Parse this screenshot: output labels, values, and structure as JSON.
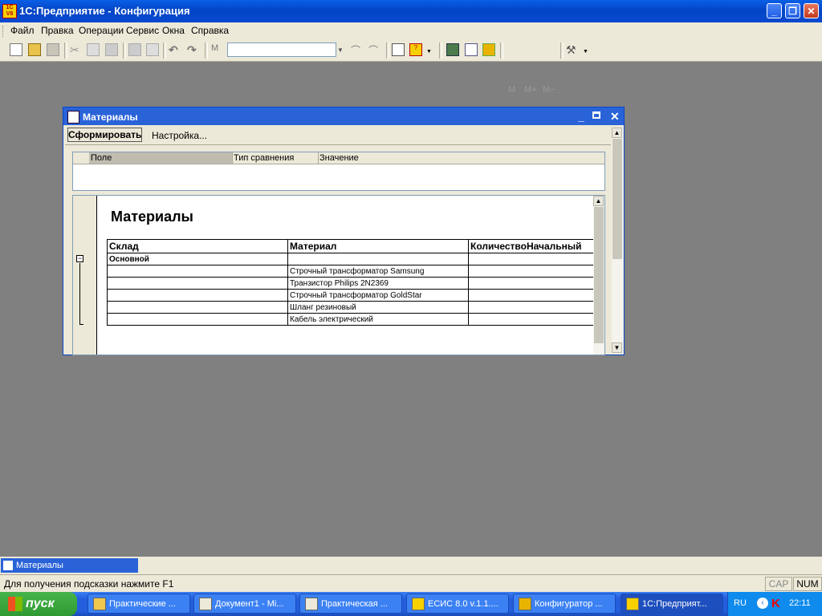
{
  "app": {
    "icon_text": "1C\nV8",
    "title": "1С:Предприятие - Конфигурация"
  },
  "menu": [
    "Файл",
    "Правка",
    "Операции",
    "Сервис",
    "Окна",
    "Справка"
  ],
  "toolbar": {
    "m_labels": [
      "M",
      "M+",
      "M−"
    ]
  },
  "window": {
    "title": "Материалы",
    "form_button": "Сформировать",
    "settings_button": "Настройка...",
    "filter_columns": [
      "Поле",
      "Тип сравнения",
      "Значение"
    ],
    "report_title": "Материалы",
    "table_headers": [
      "Склад",
      "Материал",
      "КоличествоНачальный"
    ],
    "group_row": "Основной",
    "materials": [
      "Строчный трансформатор Samsung",
      "Транзистор Philips 2N2369",
      "Строчный трансформатор GoldStar",
      "Шланг резиновый",
      "Кабель электрический"
    ]
  },
  "mdi_tab": "Материалы",
  "status": {
    "hint": "Для получения подсказки нажмите F1",
    "cap": "CAP",
    "num": "NUM"
  },
  "taskbar": {
    "start": "пуск",
    "tasks": [
      "Практические ...",
      "Документ1 - Mi...",
      "Практическая ...",
      "ЕСИС 8.0 v.1.1....",
      "Конфигуратор ...",
      "1С:Предприят..."
    ],
    "lang": "RU",
    "clock": "22:11"
  }
}
